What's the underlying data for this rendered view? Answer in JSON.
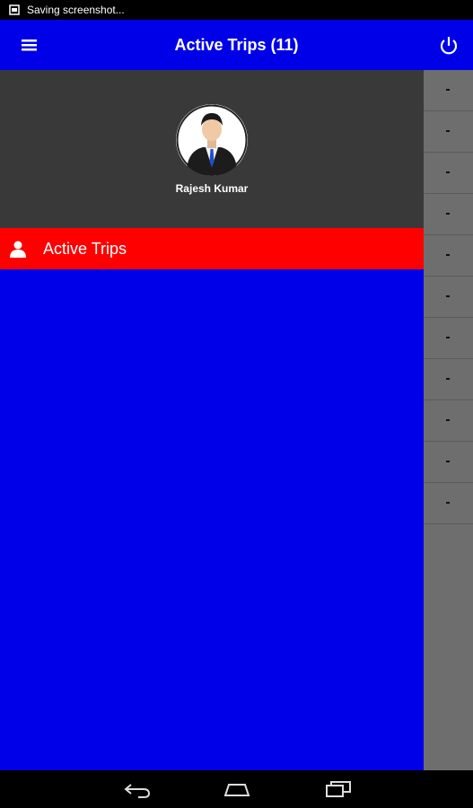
{
  "status_bar": {
    "text": "Saving screenshot...",
    "screenshot_icon": "screenshot-icon"
  },
  "app_bar": {
    "title": "Active Trips (11)",
    "menu_icon": "hamburger-menu-icon",
    "power_icon": "power-icon",
    "color": "#0000e8"
  },
  "drawer": {
    "header_color": "#393939",
    "user": {
      "name": "Rajesh Kumar",
      "avatar_icon": "user-avatar"
    },
    "items": [
      {
        "label": "Active Trips",
        "icon": "person-icon",
        "selected": true,
        "color": "#ff0000"
      }
    ]
  },
  "background_list": {
    "row_count": 11,
    "row_glyph": "•"
  },
  "nav_bar": {
    "back_icon": "back-icon",
    "home_icon": "home-icon",
    "recents_icon": "recents-icon"
  }
}
